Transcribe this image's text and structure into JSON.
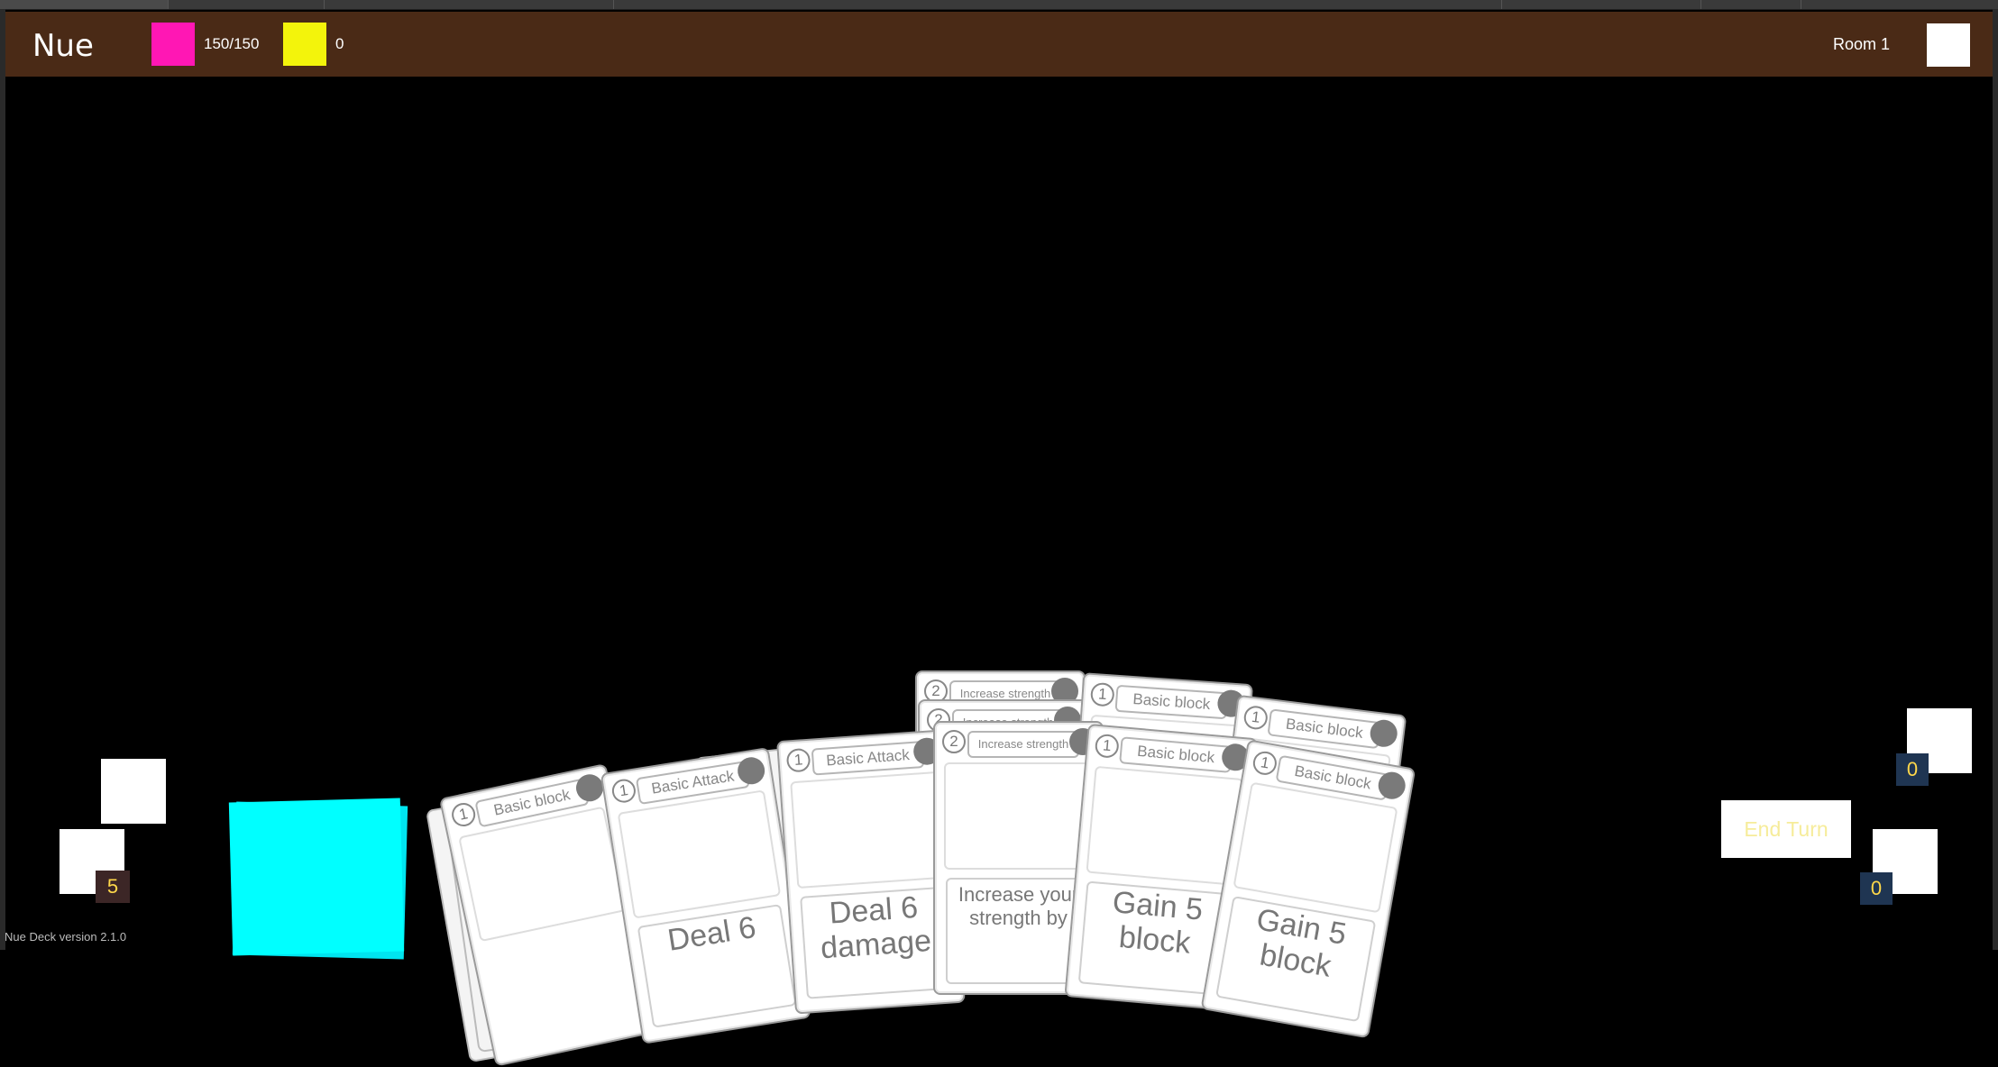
{
  "header": {
    "title": "Nue",
    "hp": "150/150",
    "energy": "0",
    "room": "Room 1",
    "colors": {
      "bar": "#4a2a16",
      "hp": "#ff17b4",
      "energy": "#f3f40b"
    }
  },
  "piles": {
    "draw_count": "5",
    "discard_count": "0",
    "exhaust_count": "0",
    "deck_color": "#00ffff"
  },
  "buttons": {
    "end_turn": "End Turn"
  },
  "footer": {
    "version": "Nue Deck version 2.1.0"
  },
  "hand": {
    "back": [
      {
        "cost": "2",
        "name": "Increase strength"
      },
      {
        "cost": "2",
        "name": "Increase strength"
      },
      {
        "cost": "1",
        "name": "Basic block"
      },
      {
        "cost": "1",
        "name": "Basic block"
      }
    ],
    "front": [
      {
        "cost": "1",
        "name": "Basic block",
        "desc": ""
      },
      {
        "cost": "1",
        "name": "Basic Attack",
        "desc": "Deal 6"
      },
      {
        "cost": "1",
        "name": "Basic Attack",
        "desc": "Deal 6 damage"
      },
      {
        "cost": "2",
        "name": "Increase strength",
        "desc": "Increase your strength by"
      },
      {
        "cost": "1",
        "name": "Basic block",
        "desc": "Gain 5 block"
      },
      {
        "cost": "1",
        "name": "Basic block",
        "desc": "Gain 5 block"
      }
    ]
  }
}
